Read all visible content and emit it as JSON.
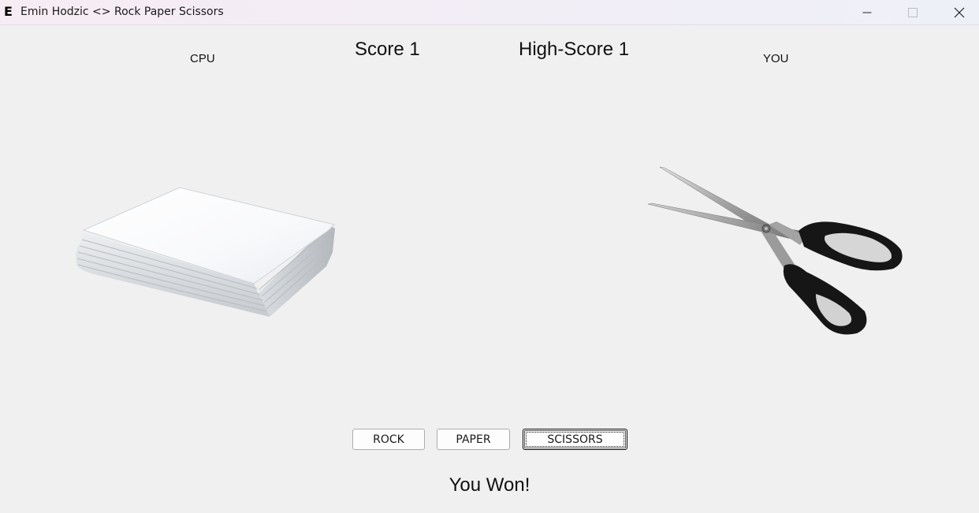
{
  "window": {
    "logo": "E",
    "title": "Emin Hodzic <> Rock Paper Scissors",
    "controls": [
      "minimize-icon",
      "maximize-icon",
      "close-icon"
    ]
  },
  "game": {
    "cpu_label": "CPU",
    "you_label": "YOU",
    "score": "Score 1",
    "high_score": "High-Score 1",
    "cpu_choice": "paper",
    "player_choice": "scissors",
    "result": "You Won!"
  },
  "buttons": {
    "rock": "ROCK",
    "paper": "PAPER",
    "scissors": "SCISSORS"
  },
  "colors": {
    "background": "#f0f0f0",
    "titlebar": "#f3edf6",
    "button_face": "#fdfdfd",
    "button_border": "#adadad"
  }
}
